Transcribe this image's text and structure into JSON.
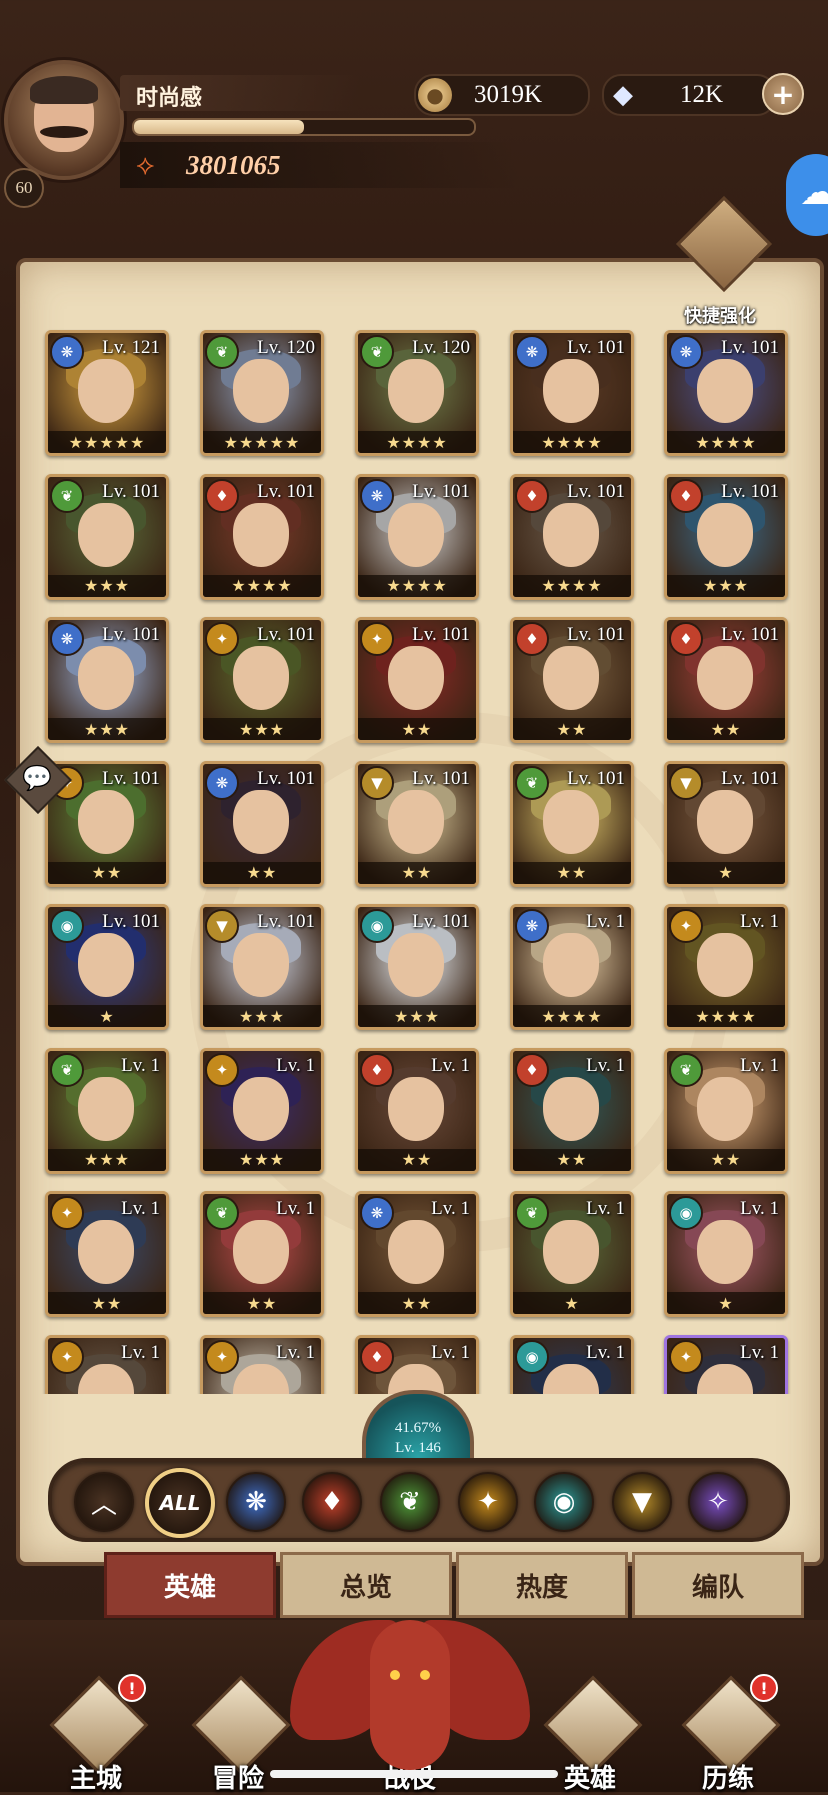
{
  "player": {
    "name": "时尚感",
    "level": "60",
    "xp_fraction": 0.5,
    "power": "3801065"
  },
  "resources": {
    "gold": "3019K",
    "gems": "12K",
    "plus": "+"
  },
  "quick_enhance": {
    "label": "快捷强化"
  },
  "chat": {
    "icon": "chat-bubble-icon",
    "glyph": "💬"
  },
  "factions": {
    "lightbearer": {
      "color": "#3f6fc9",
      "glyph": "❋"
    },
    "mauler": {
      "color": "#c2412c",
      "glyph": "♦"
    },
    "wilder": {
      "color": "#4f9a3a",
      "glyph": "❦"
    },
    "graveborn": {
      "color": "#c48a1d",
      "glyph": "✦"
    },
    "celestial": {
      "color": "#2c9a98",
      "glyph": "◉"
    },
    "hypogean": {
      "color": "#b58c2a",
      "glyph": "▼"
    },
    "dimensional": {
      "color": "#7a4ec4",
      "glyph": "✧"
    }
  },
  "heroes": [
    {
      "faction": "lightbearer",
      "level": "Lv. 121",
      "stars": "★★★★★",
      "portrait": "#d9a441"
    },
    {
      "faction": "wilder",
      "level": "Lv. 120",
      "stars": "★★★★★",
      "portrait": "#8c9bb8"
    },
    {
      "faction": "wilder",
      "level": "Lv. 120",
      "stars": "★★★★",
      "portrait": "#6f7d4a"
    },
    {
      "faction": "lightbearer",
      "level": "Lv. 101",
      "stars": "★★★★",
      "portrait": "#5a3a26"
    },
    {
      "faction": "lightbearer",
      "level": "Lv. 101",
      "stars": "★★★★",
      "portrait": "#4a4f8a"
    },
    {
      "faction": "wilder",
      "level": "Lv. 101",
      "stars": "★★★",
      "portrait": "#5a6b3a"
    },
    {
      "faction": "mauler",
      "level": "Lv. 101",
      "stars": "★★★★",
      "portrait": "#7a3a2a"
    },
    {
      "faction": "lightbearer",
      "level": "Lv. 101",
      "stars": "★★★★",
      "portrait": "#cfcfcf"
    },
    {
      "faction": "mauler",
      "level": "Lv. 101",
      "stars": "★★★★",
      "portrait": "#6a5a4a"
    },
    {
      "faction": "mauler",
      "level": "Lv. 101",
      "stars": "★★★",
      "portrait": "#3a6a8a"
    },
    {
      "faction": "lightbearer",
      "level": "Lv. 101",
      "stars": "★★★",
      "portrait": "#9bb0d8"
    },
    {
      "faction": "graveborn",
      "level": "Lv. 101",
      "stars": "★★★",
      "portrait": "#5d6b2e"
    },
    {
      "faction": "graveborn",
      "level": "Lv. 101",
      "stars": "★★",
      "portrait": "#8a2a26"
    },
    {
      "faction": "mauler",
      "level": "Lv. 101",
      "stars": "★★",
      "portrait": "#7a6040"
    },
    {
      "faction": "mauler",
      "level": "Lv. 101",
      "stars": "★★",
      "portrait": "#a0403a"
    },
    {
      "faction": "graveborn",
      "level": "Lv. 101",
      "stars": "★★",
      "portrait": "#5f8a3a"
    },
    {
      "faction": "lightbearer",
      "level": "Lv. 101",
      "stars": "★★",
      "portrait": "#3a2a3a"
    },
    {
      "faction": "hypogean",
      "level": "Lv. 101",
      "stars": "★★",
      "portrait": "#d8c79a"
    },
    {
      "faction": "wilder",
      "level": "Lv. 101",
      "stars": "★★",
      "portrait": "#d8c06a"
    },
    {
      "faction": "hypogean",
      "level": "Lv. 101",
      "stars": "★",
      "portrait": "#7a5a40"
    },
    {
      "faction": "celestial",
      "level": "Lv. 101",
      "stars": "★",
      "portrait": "#2a3a8a"
    },
    {
      "faction": "hypogean",
      "level": "Lv. 101",
      "stars": "★★★",
      "portrait": "#cfd6e6"
    },
    {
      "faction": "celestial",
      "level": "Lv. 101",
      "stars": "★★★",
      "portrait": "#e8eef4"
    },
    {
      "faction": "lightbearer",
      "level": "Lv. 1",
      "stars": "★★★★",
      "portrait": "#e6cfa8"
    },
    {
      "faction": "graveborn",
      "level": "Lv. 1",
      "stars": "★★★★",
      "portrait": "#7a6a2a"
    },
    {
      "faction": "wilder",
      "level": "Lv. 1",
      "stars": "★★★",
      "portrait": "#6a8a3a"
    },
    {
      "faction": "graveborn",
      "level": "Lv. 1",
      "stars": "★★★",
      "portrait": "#3a2a6a"
    },
    {
      "faction": "mauler",
      "level": "Lv. 1",
      "stars": "★★",
      "portrait": "#6a4a3a"
    },
    {
      "faction": "mauler",
      "level": "Lv. 1",
      "stars": "★★",
      "portrait": "#2f5a5a"
    },
    {
      "faction": "wilder",
      "level": "Lv. 1",
      "stars": "★★",
      "portrait": "#d8a878"
    },
    {
      "faction": "graveborn",
      "level": "Lv. 1",
      "stars": "★★",
      "portrait": "#3a4a6a"
    },
    {
      "faction": "wilder",
      "level": "Lv. 1",
      "stars": "★★",
      "portrait": "#b84a4a"
    },
    {
      "faction": "lightbearer",
      "level": "Lv. 1",
      "stars": "★★",
      "portrait": "#7a5a3a"
    },
    {
      "faction": "wilder",
      "level": "Lv. 1",
      "stars": "★",
      "portrait": "#5a6a3a"
    },
    {
      "faction": "celestial",
      "level": "Lv. 1",
      "stars": "★",
      "portrait": "#a85a6a"
    },
    {
      "faction": "graveborn",
      "level": "Lv. 1",
      "stars": "",
      "portrait": "#6a5a4a"
    },
    {
      "faction": "graveborn",
      "level": "Lv. 1",
      "stars": "",
      "portrait": "#d8d0c0"
    },
    {
      "faction": "mauler",
      "level": "Lv. 1",
      "stars": "",
      "portrait": "#8a6a4a"
    },
    {
      "faction": "celestial",
      "level": "Lv. 1",
      "stars": "",
      "portrait": "#2a3a5a"
    },
    {
      "faction": "graveborn",
      "level": "Lv. 1",
      "stars": "",
      "portrait": "#3a3a4a",
      "purple": true
    }
  ],
  "collection": {
    "percent": "41.67%",
    "level": "Lv. 146"
  },
  "filters": [
    {
      "name": "collapse",
      "glyph": "︿",
      "color": "#4a3323"
    },
    {
      "name": "all",
      "glyph": "ALL",
      "color": "#4a3323"
    },
    {
      "name": "lightbearer",
      "glyph": "❋",
      "color": "#3f6fc9"
    },
    {
      "name": "mauler",
      "glyph": "♦",
      "color": "#c2412c"
    },
    {
      "name": "wilder",
      "glyph": "❦",
      "color": "#4f9a3a"
    },
    {
      "name": "graveborn",
      "glyph": "✦",
      "color": "#c48a1d"
    },
    {
      "name": "celestial",
      "glyph": "◉",
      "color": "#2c9a98"
    },
    {
      "name": "hypogean",
      "glyph": "▼",
      "color": "#b58c2a"
    },
    {
      "name": "dimensional",
      "glyph": "✧",
      "color": "#7a4ec4"
    }
  ],
  "tabs": [
    {
      "label": "英雄",
      "active": true
    },
    {
      "label": "总览",
      "active": false
    },
    {
      "label": "热度",
      "active": false
    },
    {
      "label": "编队",
      "active": false
    }
  ],
  "nav": [
    {
      "label": "主城",
      "alert": "!"
    },
    {
      "label": "冒险",
      "alert": ""
    },
    {
      "label": "战役",
      "alert": ""
    },
    {
      "label": "英雄",
      "alert": ""
    },
    {
      "label": "历练",
      "alert": "!"
    }
  ]
}
